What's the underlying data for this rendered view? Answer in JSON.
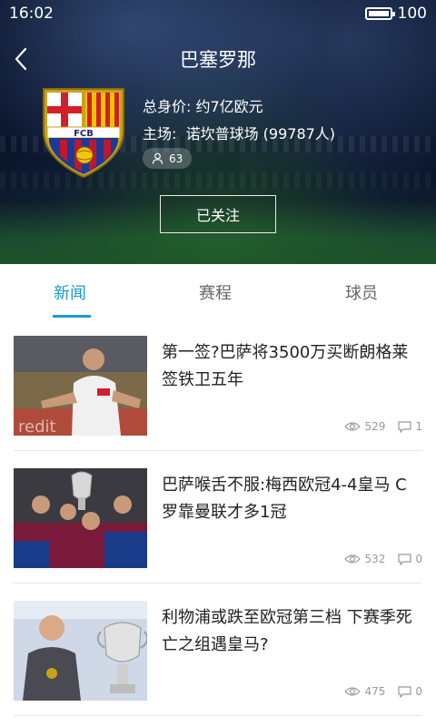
{
  "status": {
    "time": "16:02",
    "battery": "100",
    "battery_level": 1.0
  },
  "header": {
    "title": "巴塞罗那"
  },
  "team": {
    "value_label": "总身价:",
    "value": "约7亿欧元",
    "stadium_label": "主场:",
    "stadium": "诺坎普球场 (99787人)",
    "fans_count": "63",
    "crest_text": "FCB"
  },
  "follow_button": {
    "label": "已关注"
  },
  "tabs": [
    {
      "label": "新闻",
      "active": true
    },
    {
      "label": "赛程",
      "active": false
    },
    {
      "label": "球员",
      "active": false
    }
  ],
  "news": [
    {
      "headline": "第一签?巴萨将3500万买断朗格莱 签铁卫五年",
      "views": "529",
      "comments": "1"
    },
    {
      "headline": "巴萨喉舌不服:梅西欧冠4-4皇马 C罗靠曼联才多1冠",
      "views": "532",
      "comments": "0"
    },
    {
      "headline": "利物浦或跌至欧冠第三档 下赛季死亡之组遇皇马?",
      "views": "475",
      "comments": "0"
    }
  ],
  "colors": {
    "accent": "#1b9ad6",
    "text": "#222222",
    "meta": "#999999"
  }
}
